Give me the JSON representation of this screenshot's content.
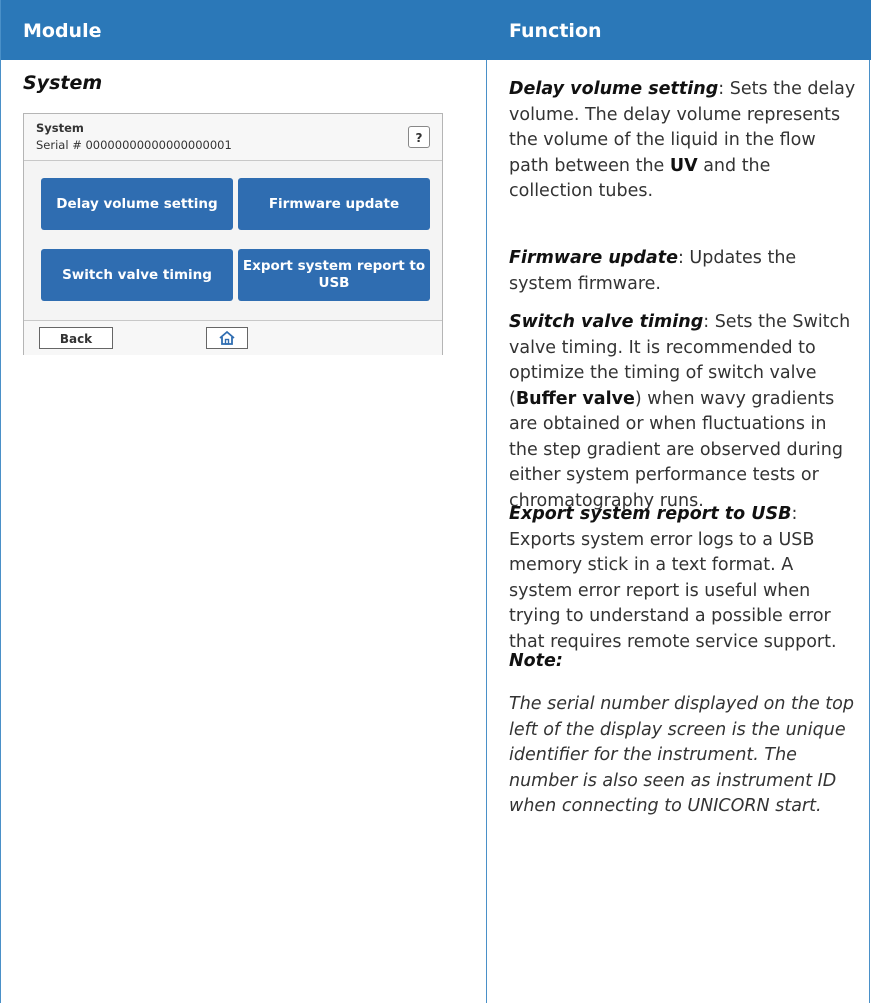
{
  "header": {
    "module": "Module",
    "function": "Function"
  },
  "module": {
    "title": "System",
    "screen": {
      "system_label": "System",
      "serial_label": "Serial # 00000000000000000001",
      "help": "?",
      "buttons": [
        "Delay volume setting",
        "Firmware update",
        "Switch valve timing",
        "Export system report to USB"
      ],
      "back": "Back",
      "home_icon": "home-icon"
    }
  },
  "functions": {
    "delay": {
      "name": "Delay volume setting",
      "text_a": ": Sets the delay volume. The delay volume represents the volume of the liquid in the flow path between the ",
      "bold": "UV",
      "text_b": " and the collection tubes."
    },
    "firmware": {
      "name": "Firmware update",
      "text": ": Updates the system firmware."
    },
    "switch": {
      "name": "Switch valve timing",
      "text_a": ": Sets the Switch valve timing. It is recommended to optimize the timing of switch valve (",
      "bold": "Buffer valve",
      "text_b": ") when wavy gradients are obtained or when fluctuations in the step gradient are observed during either system performance tests or chromatography runs."
    },
    "export": {
      "name": "Export system report to USB",
      "colon": ":",
      "text": "Exports system error logs to a USB memory stick in a text format. A system error report is useful when trying to understand a possible error that requires remote service support."
    },
    "note": {
      "title": "Note:",
      "text": "The serial number displayed on the top left of the display screen is the unique identifier for the instrument. The number is also seen as instrument ID when connecting to UNICORN start."
    }
  },
  "colors": {
    "header_bg": "#2b78b8",
    "button_bg": "#2f6db1",
    "border": "#4a90c8"
  }
}
